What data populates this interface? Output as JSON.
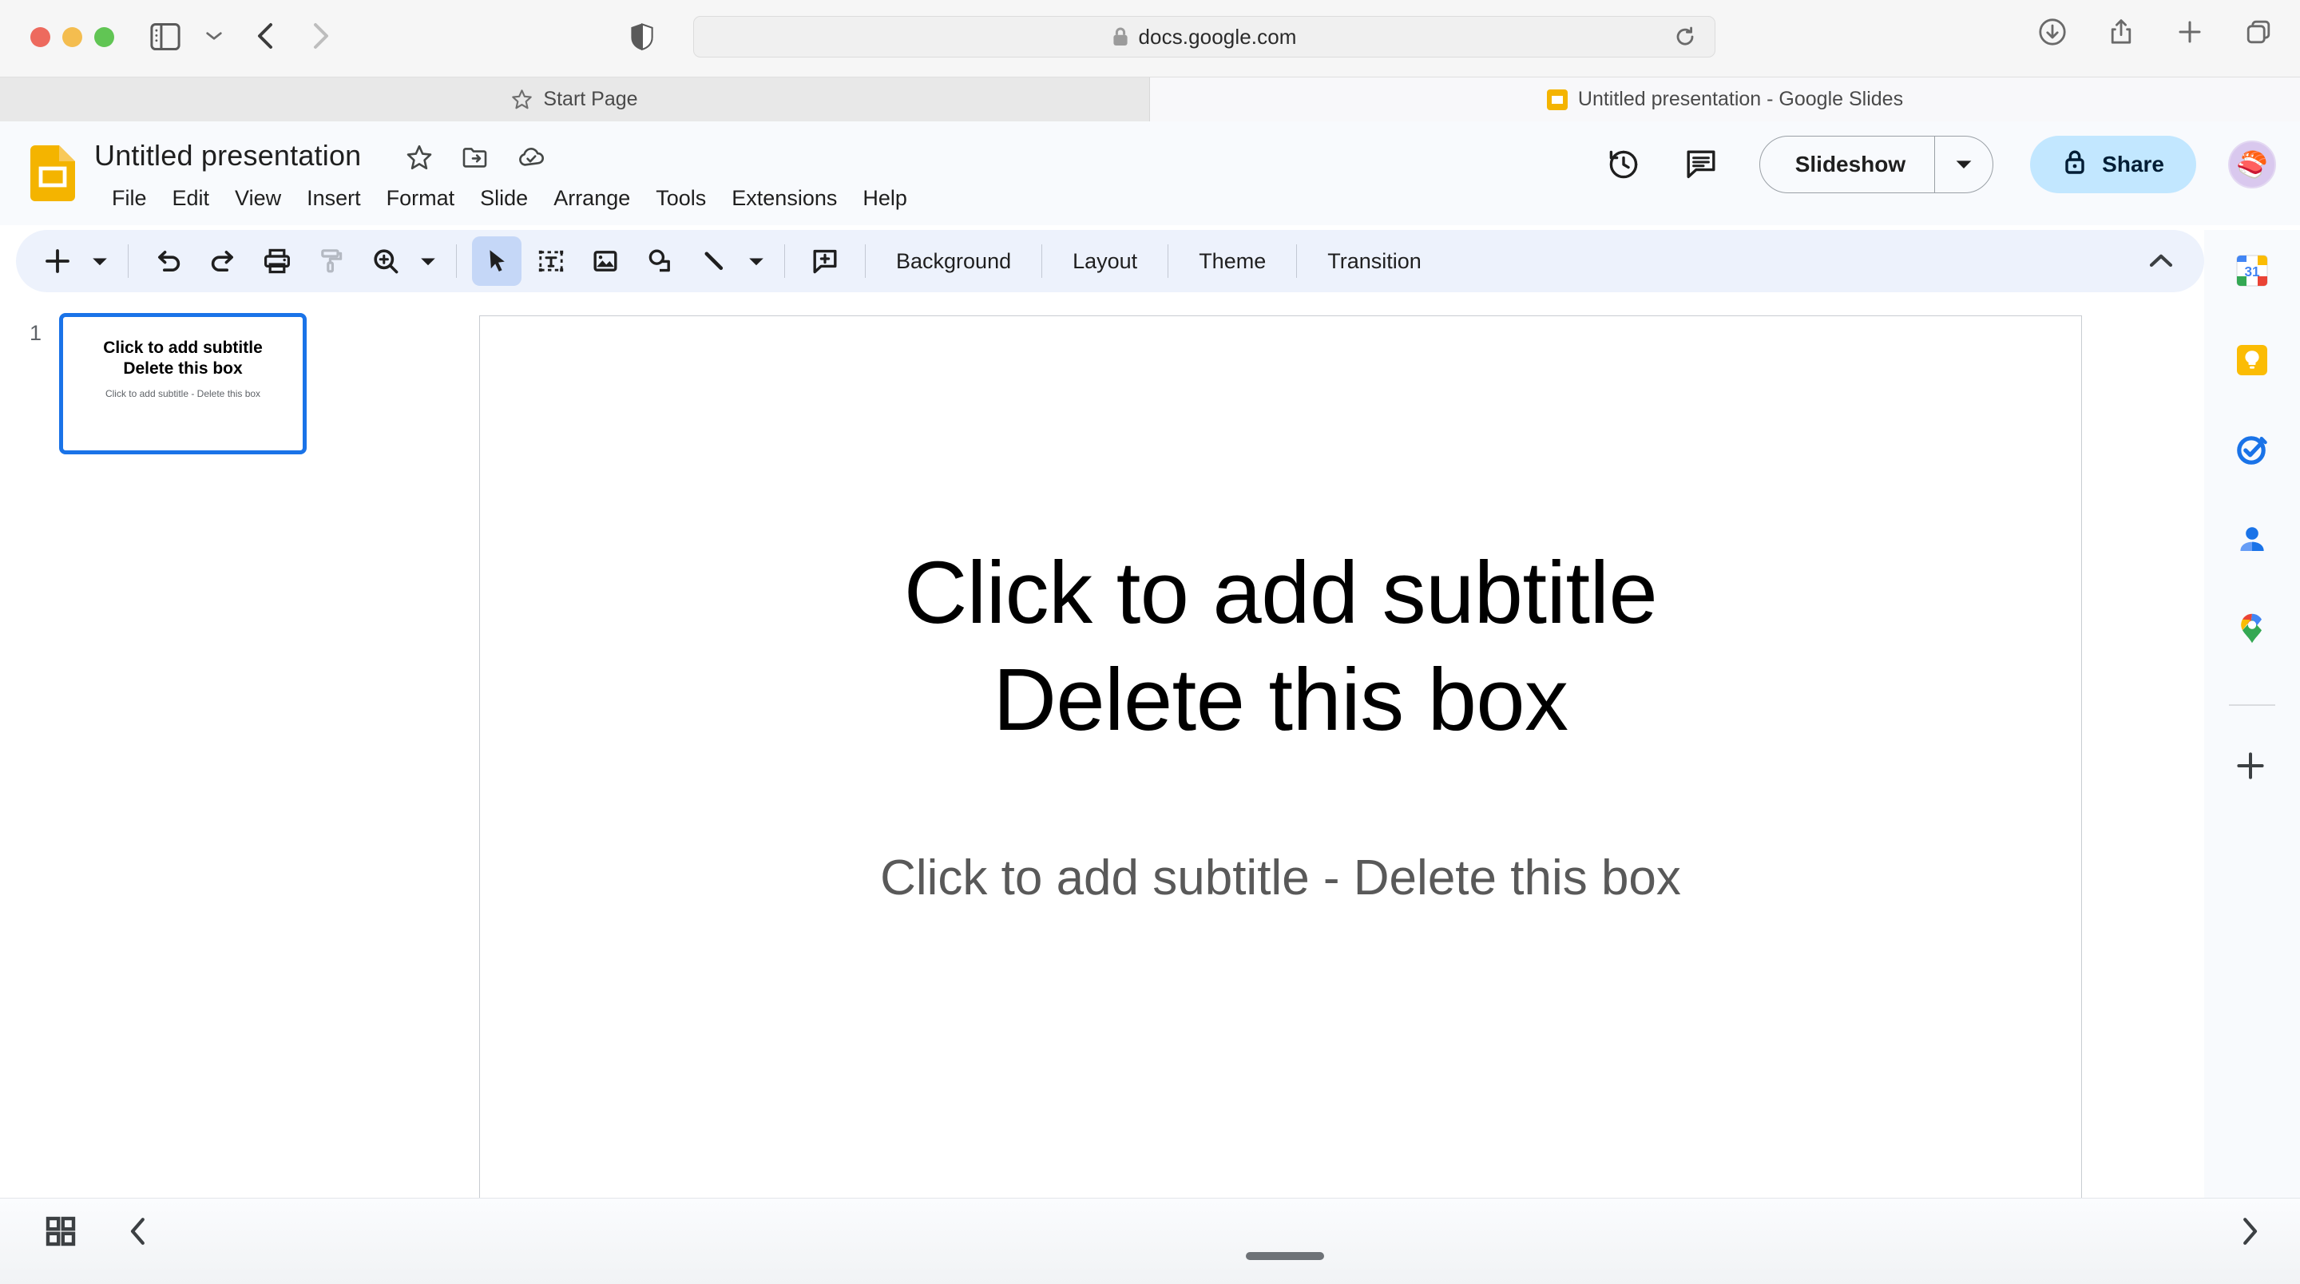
{
  "browser": {
    "url": "docs.google.com",
    "lock_icon": "lock-icon",
    "shield_icon": "shield-icon",
    "reload_icon": "reload-icon",
    "back_icon": "back-chevron-icon",
    "forward_icon": "forward-chevron-icon",
    "sidebar_icon": "sidebar-toggle-icon",
    "downloads_icon": "downloads-icon",
    "share_icon": "share-icon",
    "newtab_icon": "plus-icon",
    "tabs_overview_icon": "tab-overview-icon",
    "traffic_lights": [
      "close",
      "minimize",
      "zoom"
    ],
    "tabs": [
      {
        "label": "Start Page",
        "icon": "star-icon",
        "active": false
      },
      {
        "label": "Untitled presentation - Google Slides",
        "icon": "slides-favicon",
        "active": true
      }
    ]
  },
  "app": {
    "logo": "google-slides-logo",
    "doc_title": "Untitled presentation",
    "title_icons": [
      {
        "name": "star-icon"
      },
      {
        "name": "move-to-folder-icon"
      },
      {
        "name": "cloud-saved-icon"
      }
    ],
    "menus": [
      "File",
      "Edit",
      "View",
      "Insert",
      "Format",
      "Slide",
      "Arrange",
      "Tools",
      "Extensions",
      "Help"
    ],
    "header_actions": {
      "history_icon": "version-history-icon",
      "comment_icon": "comment-icon",
      "slideshow_label": "Slideshow",
      "slideshow_caret": "chevron-down-icon",
      "share_label": "Share",
      "share_lock_icon": "lock-icon",
      "avatar": "user-avatar"
    }
  },
  "toolbar": {
    "buttons": [
      {
        "name": "new-slide-button",
        "icon": "plus-icon"
      },
      {
        "name": "new-slide-dropdown",
        "icon": "chevron-down-icon"
      },
      {
        "name": "undo-button",
        "icon": "undo-icon"
      },
      {
        "name": "redo-button",
        "icon": "redo-icon"
      },
      {
        "name": "print-button",
        "icon": "print-icon"
      },
      {
        "name": "paint-format-button",
        "icon": "paint-roller-icon",
        "disabled": true
      },
      {
        "name": "zoom-button",
        "icon": "zoom-in-icon"
      },
      {
        "name": "zoom-dropdown",
        "icon": "chevron-down-icon"
      },
      {
        "name": "select-tool-button",
        "icon": "cursor-arrow-icon",
        "active": true
      },
      {
        "name": "text-box-button",
        "icon": "text-box-icon"
      },
      {
        "name": "insert-image-button",
        "icon": "image-icon"
      },
      {
        "name": "shape-button",
        "icon": "shape-icon"
      },
      {
        "name": "line-button",
        "icon": "line-icon"
      },
      {
        "name": "line-dropdown",
        "icon": "chevron-down-icon"
      },
      {
        "name": "add-comment-button",
        "icon": "add-comment-icon"
      }
    ],
    "text_buttons": [
      "Background",
      "Layout",
      "Theme",
      "Transition"
    ],
    "collapse_icon": "chevron-up-icon"
  },
  "side_panel": {
    "items": [
      {
        "name": "google-calendar-icon",
        "label": "31"
      },
      {
        "name": "google-keep-icon",
        "label": ""
      },
      {
        "name": "google-tasks-icon",
        "label": ""
      },
      {
        "name": "google-contacts-icon",
        "label": ""
      },
      {
        "name": "google-maps-icon",
        "label": ""
      }
    ],
    "add_icon": "plus-icon"
  },
  "filmstrip": {
    "slides": [
      {
        "number": "1",
        "title": "Click to add subtitle\nDelete this box",
        "title_line1": "Click to add subtitle",
        "title_line2": "Delete this box",
        "subtitle": "Click to add subtitle - Delete this box",
        "selected": true
      }
    ]
  },
  "canvas": {
    "slide": {
      "title_line1": "Click to add subtitle",
      "title_line2": "Delete this box",
      "subtitle": "Click to add subtitle - Delete this box"
    }
  },
  "bottom_bar": {
    "grid_view_icon": "grid-view-icon",
    "collapse_filmstrip_icon": "chevron-left-icon",
    "notes_handle": "speaker-notes-drag-handle",
    "expand_panel_icon": "chevron-right-icon"
  },
  "colors": {
    "accent": "#1a73e8",
    "share_bg": "#c2e7ff",
    "toolbar_bg": "#edf2fc",
    "header_bg": "#f8fafd",
    "slides_yellow": "#f4b400"
  }
}
